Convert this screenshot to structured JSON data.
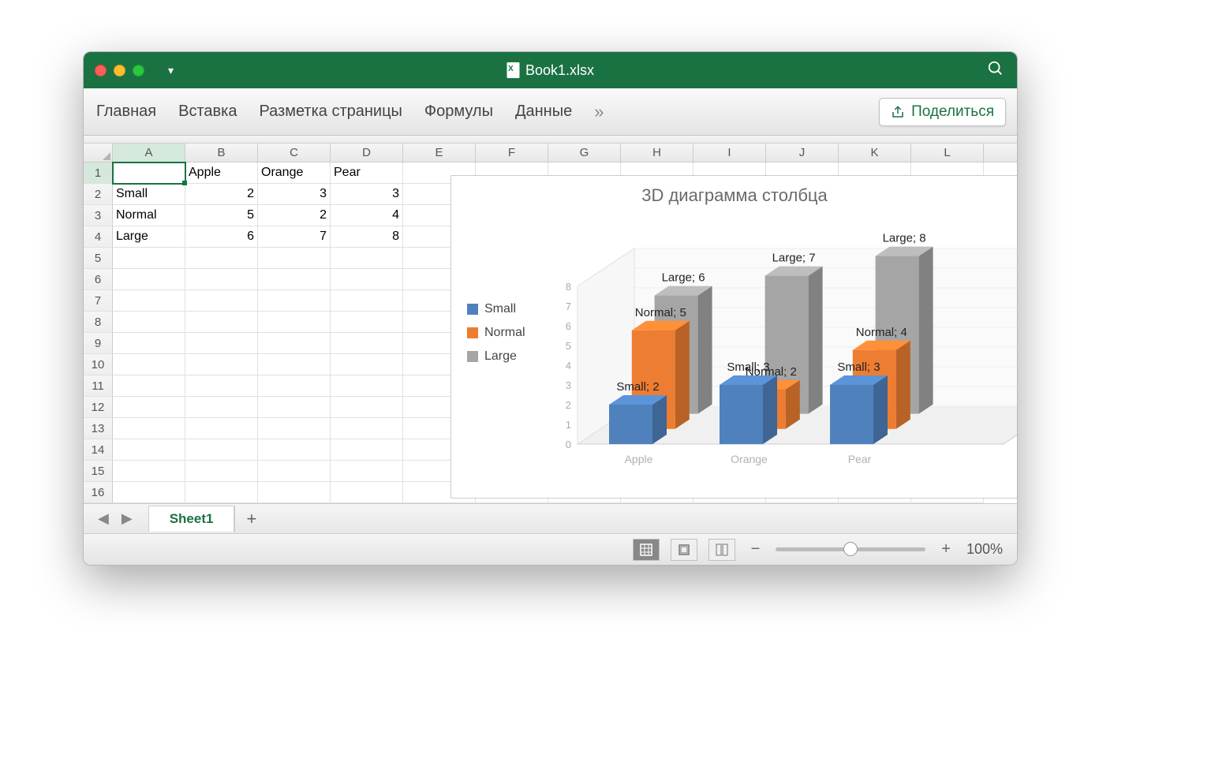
{
  "window": {
    "title": "Book1.xlsx"
  },
  "ribbon": {
    "tabs": [
      "Главная",
      "Вставка",
      "Разметка страницы",
      "Формулы",
      "Данные"
    ],
    "more": "»",
    "share": "Поделиться"
  },
  "columns": [
    "A",
    "B",
    "C",
    "D",
    "E",
    "F",
    "G",
    "H",
    "I",
    "J",
    "K",
    "L"
  ],
  "rows": [
    1,
    2,
    3,
    4,
    5,
    6,
    7,
    8,
    9,
    10,
    11,
    12,
    13,
    14,
    15,
    16
  ],
  "sheet": {
    "headers": {
      "B1": "Apple",
      "C1": "Orange",
      "D1": "Pear"
    },
    "rowLabels": {
      "A2": "Small",
      "A3": "Normal",
      "A4": "Large"
    },
    "values": {
      "B2": 2,
      "C2": 3,
      "D2": 3,
      "B3": 5,
      "C3": 2,
      "D3": 4,
      "B4": 6,
      "C4": 7,
      "D4": 8
    }
  },
  "chart": {
    "title": "3D диаграмма столбца",
    "legend": [
      "Small",
      "Normal",
      "Large"
    ],
    "categories": [
      "Apple",
      "Orange",
      "Pear"
    ],
    "yticks": [
      0,
      1,
      2,
      3,
      4,
      5,
      6,
      7,
      8
    ],
    "colors": {
      "Small": "#4f81bd",
      "Normal": "#ed7d31",
      "Large": "#a5a5a5"
    },
    "labels": {
      "Apple": {
        "Small": "Small; 2",
        "Normal": "Normal; 5",
        "Large": "Large; 6"
      },
      "Orange": {
        "Small": "Small; 3",
        "Normal": "Normal; 2",
        "Large": "Large; 7"
      },
      "Pear": {
        "Small": "Small; 3",
        "Normal": "Normal; 4",
        "Large": "Large; 8"
      }
    }
  },
  "tabs": {
    "active": "Sheet1"
  },
  "status": {
    "zoom": "100%"
  },
  "chart_data": {
    "type": "bar",
    "title": "3D диаграмма столбца",
    "categories": [
      "Apple",
      "Orange",
      "Pear"
    ],
    "series": [
      {
        "name": "Small",
        "values": [
          2,
          3,
          3
        ]
      },
      {
        "name": "Normal",
        "values": [
          5,
          2,
          4
        ]
      },
      {
        "name": "Large",
        "values": [
          6,
          7,
          8
        ]
      }
    ],
    "ylabel": "",
    "xlabel": "",
    "ylim": [
      0,
      8
    ]
  }
}
